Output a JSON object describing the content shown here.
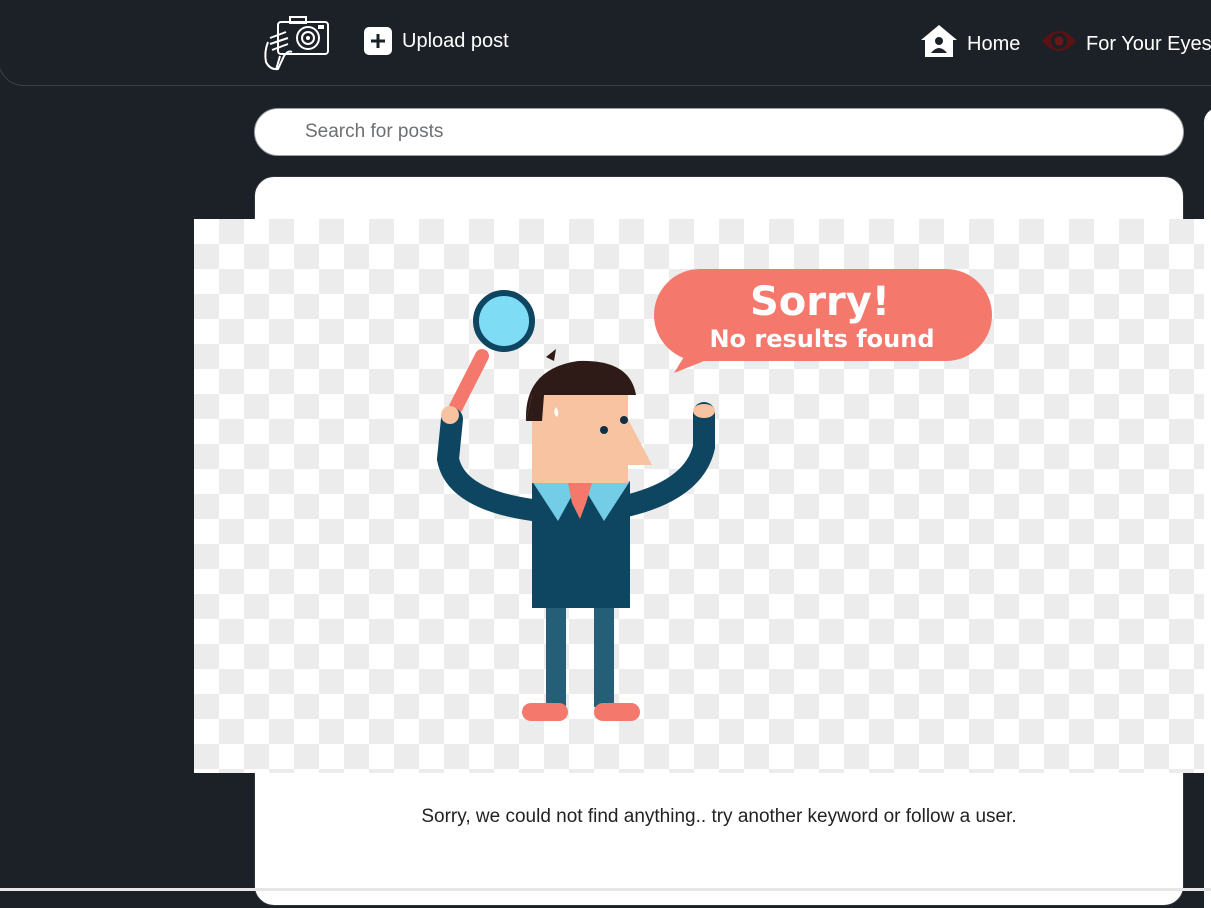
{
  "header": {
    "upload_label": "Upload post",
    "nav": [
      {
        "label": "Home",
        "icon": "home-icon"
      },
      {
        "label": "For Your Eyes",
        "icon": "eye-icon"
      }
    ]
  },
  "search": {
    "placeholder": "Search for posts"
  },
  "results": {
    "illustration": {
      "bubble_title": "Sorry!",
      "bubble_subtitle": "No results found"
    },
    "message": "Sorry, we could not find anything.. try another keyword or follow a user."
  },
  "colors": {
    "background": "#1c2027",
    "bubble": "#f4786c",
    "eye_icon": "#7a1a1a",
    "suit": "#0e4661"
  }
}
